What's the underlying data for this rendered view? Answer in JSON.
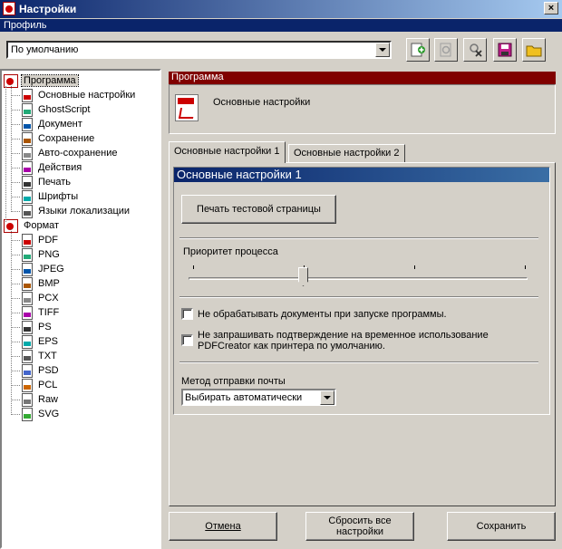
{
  "window": {
    "title": "Настройки",
    "close_glyph": "×"
  },
  "profile": {
    "header": "Профиль",
    "selected": "По умолчанию"
  },
  "toolbar": {
    "icons": [
      "add-profile-icon",
      "rename-profile-icon",
      "delete-profile-icon",
      "save-profile-icon",
      "load-profile-icon"
    ]
  },
  "tree": {
    "program": {
      "label": "Программа",
      "items": [
        "Основные настройки",
        "GhostScript",
        "Документ",
        "Сохранение",
        "Авто-сохранение",
        "Действия",
        "Печать",
        "Шрифты",
        "Языки локализации"
      ]
    },
    "format": {
      "label": "Формат",
      "items": [
        "PDF",
        "PNG",
        "JPEG",
        "BMP",
        "PCX",
        "TIFF",
        "PS",
        "EPS",
        "TXT",
        "PSD",
        "PCL",
        "Raw",
        "SVG"
      ]
    }
  },
  "panel": {
    "header": "Программа",
    "info_text": "Основные настройки",
    "tabs": [
      "Основные настройки 1",
      "Основные настройки 2"
    ],
    "group_title": "Основные настройки 1",
    "print_test_button": "Печать тестовой страницы",
    "priority_label": "Приоритет процесса",
    "priority_level": 0.25,
    "checkbox_1": "Не обрабатывать документы при запуске программы.",
    "checkbox_1_checked": false,
    "checkbox_2_line1": "Не запрашивать подтверждение на временное использование",
    "checkbox_2_line2": "PDFCreator как принтера по умолчанию.",
    "checkbox_2_checked": false,
    "mail_label": "Метод отправки почты",
    "mail_value": "Выбирать автоматически"
  },
  "buttons": {
    "cancel": "Отмена",
    "reset_line1": "Сбросить все",
    "reset_line2": "настройки",
    "save": "Сохранить"
  },
  "colors": {
    "titlebar": "#0a246a",
    "panel_header": "#800000",
    "face": "#d4d0c8"
  }
}
